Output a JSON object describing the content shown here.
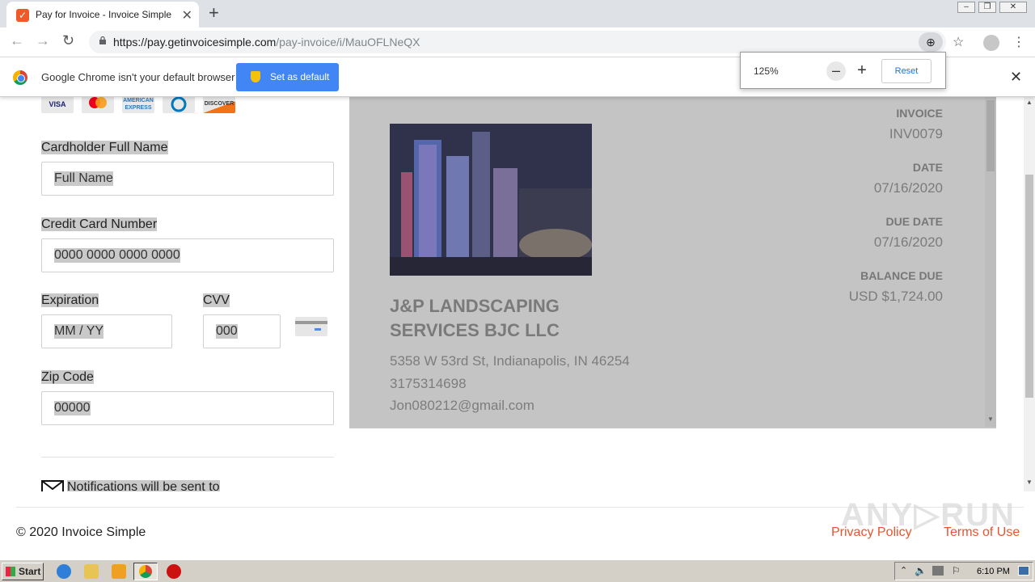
{
  "browser": {
    "tab_title": "Pay for Invoice - Invoice Simple",
    "url_host": "https://pay.getinvoicesimple.com",
    "url_path": "/pay-invoice/i/MauOFLNeQX"
  },
  "infobar": {
    "message": "Google Chrome isn't your default browser",
    "button": "Set as default"
  },
  "zoom": {
    "level": "125%",
    "reset": "Reset"
  },
  "payment_form": {
    "card_logos": [
      "VISA",
      "mastercard",
      "AMERICAN EXPRESS",
      "Diners",
      "DISCOVER"
    ],
    "cardholder_label": "Cardholder Full Name",
    "cardholder_placeholder": "Full Name",
    "card_number_label": "Credit Card Number",
    "card_number_placeholder": "0000 0000 0000 0000",
    "expiration_label": "Expiration",
    "expiration_placeholder": "MM / YY",
    "cvv_label": "CVV",
    "cvv_placeholder": "000",
    "zip_label": "Zip Code",
    "zip_placeholder": "00000",
    "notifications_text": "Notifications will be sent to"
  },
  "invoice": {
    "invoice_label": "INVOICE",
    "invoice_number": "INV0079",
    "date_label": "DATE",
    "date": "07/16/2020",
    "due_label": "DUE DATE",
    "due_date": "07/16/2020",
    "balance_label": "BALANCE DUE",
    "balance": "USD $1,724.00",
    "business_name": "J&P LANDSCAPING SERVICES BJC LLC",
    "address": "5358 W 53rd St, Indianapolis, IN 46254",
    "phone": "3175314698",
    "email": "Jon080212@gmail.com"
  },
  "footer": {
    "copyright": "© 2020 Invoice Simple",
    "privacy": "Privacy Policy",
    "terms": "Terms of Use"
  },
  "taskbar": {
    "start": "Start",
    "time": "6:10 PM"
  },
  "colors": {
    "accent_orange": "#e8542f",
    "chrome_blue": "#4285f4",
    "panel_gray": "#c4c4c4"
  }
}
